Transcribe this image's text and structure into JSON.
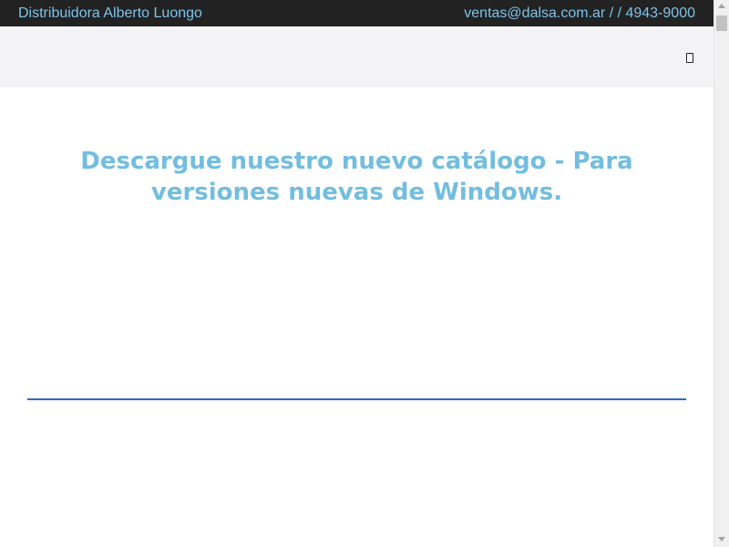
{
  "topbar": {
    "brand": "Distribuidora Alberto Luongo",
    "contact": "ventas@dalsa.com.ar / / 4943-9000"
  },
  "navbar": {
    "menu_icon": "menu-toggle-icon"
  },
  "main": {
    "headline": "Descargue nuestro nuevo catálogo - Para versiones nuevas de Windows."
  },
  "colors": {
    "topbar_bg": "#222222",
    "topbar_text": "#7cc4ea",
    "navbar_bg": "#f4f4f6",
    "headline": "#72bde0",
    "divider": "#2b6cb7"
  }
}
